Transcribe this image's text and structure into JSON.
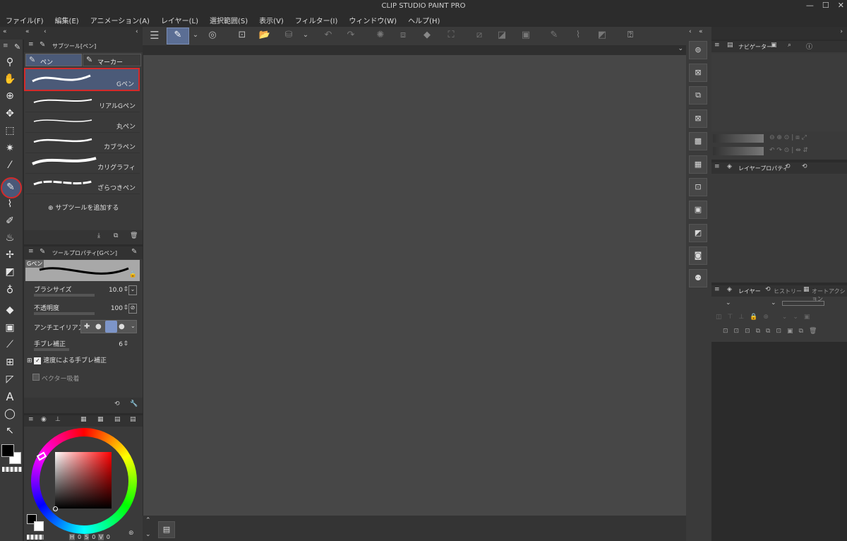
{
  "app": {
    "title": "CLIP STUDIO PAINT PRO"
  },
  "menu": [
    "ファイル(F)",
    "編集(E)",
    "アニメーション(A)",
    "レイヤー(L)",
    "選択範囲(S)",
    "表示(V)",
    "フィルター(I)",
    "ウィンドウ(W)",
    "ヘルプ(H)"
  ],
  "subtool_panel": {
    "tab_title": "サブツール[ペン]",
    "tabs": [
      "ペン",
      "マーカー"
    ],
    "brushes": [
      "Gペン",
      "リアルGペン",
      "丸ペン",
      "カブラペン",
      "カリグラフィ",
      "ざらつきペン"
    ],
    "add_label": "サブツールを追加する"
  },
  "tool_property": {
    "tab_title": "ツールプロパティ[Gペン]",
    "preview_label": "Gペン",
    "brush_size_label": "ブラシサイズ",
    "brush_size_value": "10.0",
    "opacity_label": "不透明度",
    "opacity_value": "100",
    "antialias_label": "アンチエイリアス",
    "stabilization_label": "手ブレ補正",
    "stabilization_value": "6",
    "speed_stab_label": "速度による手ブレ補正",
    "vector_snap_label": "ベクター吸着"
  },
  "color": {
    "hsv": [
      "H",
      "0",
      "S",
      "0",
      "V",
      "0"
    ],
    "main": "#000000",
    "sub": "#ffffff"
  },
  "right_panels": {
    "navigator": "ナビゲーター",
    "layer_property": "レイヤープロパティ",
    "layer": "レイヤー",
    "history": "ヒストリー",
    "auto_action": "オートアクション"
  },
  "icons": {
    "left_tools": [
      "zoom-icon",
      "hand-icon",
      "rotate-icon",
      "move-icon",
      "selection-icon",
      "magic-wand-icon",
      "eyedropper-icon",
      "pen-icon",
      "brush-icon",
      "pencil-icon",
      "airbrush-icon",
      "decoration-icon",
      "eraser-icon",
      "blend-icon",
      "fill-icon",
      "gradient-icon",
      "line-icon",
      "frame-icon",
      "ruler-icon",
      "text-icon",
      "balloon-icon",
      "correction-icon"
    ],
    "top_toolbar": [
      "menu-icon",
      "pen-mode-icon",
      "dropdown-icon",
      "layer-icon",
      "new-icon",
      "open-icon",
      "save-icon",
      "dropdown-icon",
      "undo-icon",
      "redo-icon",
      "sparkle-icon",
      "transform-icon",
      "fill-icon",
      "crop-icon",
      "clear-icon",
      "fill-out-icon",
      "select-all-icon",
      "pen-sel-icon",
      "brush-sel-icon",
      "eraser-sel-icon",
      "help-icon"
    ]
  },
  "accent": "#cc2b2b",
  "canvas_color": "#474747"
}
